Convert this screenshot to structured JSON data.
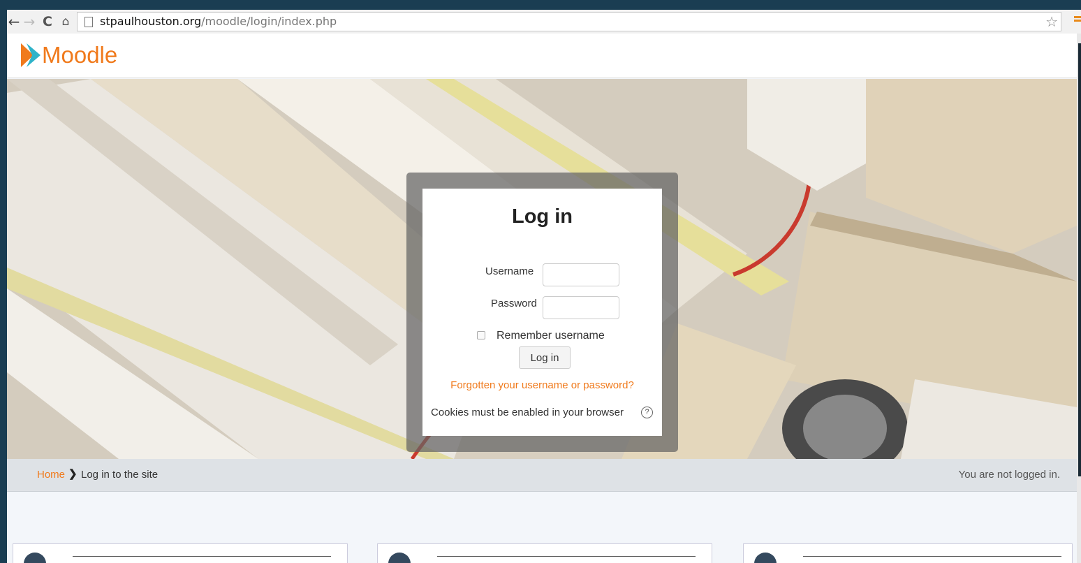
{
  "browser": {
    "url_host": "stpaulhouston.org",
    "url_path": "/moodle/login/index.php"
  },
  "site": {
    "logo_text": "Moodle"
  },
  "login": {
    "title": "Log in",
    "username_label": "Username",
    "password_label": "Password",
    "username_value": "",
    "password_value": "",
    "remember_label": "Remember username",
    "remember_checked": false,
    "submit_label": "Log in",
    "forgot_link": "Forgotten your username or password?",
    "cookies_notice": "Cookies must be enabled in your browser",
    "help_symbol": "?"
  },
  "breadcrumb": {
    "home": "Home",
    "separator": "❯",
    "current": "Log in to the site"
  },
  "status": {
    "login_info": "You are not logged in."
  },
  "colors": {
    "brand_orange": "#f07a1c",
    "frame": "#1a3d52"
  }
}
